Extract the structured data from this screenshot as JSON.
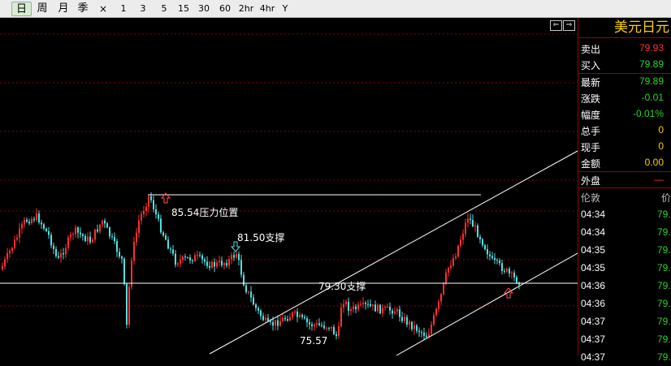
{
  "toolbar": {
    "day": "日",
    "week": "周",
    "month": "月",
    "season": "季",
    "close": "×",
    "m1": "1",
    "m3": "3",
    "m5": "5",
    "m15": "15",
    "m30": "30",
    "m60": "60",
    "h2": "2hr",
    "h4": "4hr",
    "year": "Y"
  },
  "annotations": {
    "resistance": "85.54压力位置",
    "support1": "81.50支撑",
    "support2": "79.30支撑",
    "low": "75.57"
  },
  "panel": {
    "title": "美元日元",
    "sell_label": "卖出",
    "sell_value": "79.93",
    "buy_label": "买入",
    "buy_value": "79.89",
    "latest_label": "最新",
    "latest_value": "79.89",
    "change_label": "涨跌",
    "change_value": "-0.01",
    "pct_label": "幅度",
    "pct_value": "-0.01%",
    "volume_label": "总手",
    "volume_value": "0",
    "current_label": "现手",
    "current_value": "0",
    "amount_label": "金额",
    "amount_value": "0.00",
    "outer_label": "外盘",
    "outer_value": "—",
    "ticks_header_left": "伦敦",
    "ticks_header_right": "价",
    "ticks": [
      {
        "time": "04:34",
        "price": "79."
      },
      {
        "time": "04:34",
        "price": "79."
      },
      {
        "time": "04:35",
        "price": "79."
      },
      {
        "time": "04:35",
        "price": "79."
      },
      {
        "time": "04:36",
        "price": "79."
      },
      {
        "time": "04:36",
        "price": "79."
      },
      {
        "time": "04:37",
        "price": "79."
      },
      {
        "time": "04:37",
        "price": "79."
      },
      {
        "time": "04:37",
        "price": "79."
      }
    ]
  },
  "colors": {
    "up": "#ff3030",
    "down": "#54e0e0",
    "grid": "#8a0000",
    "accent": "#f7d000",
    "positive": "#2ed42e"
  },
  "icons": {
    "nav_left": "scroll-left-icon",
    "nav_right": "scroll-right-icon",
    "resistance_arrow": "arrow-up-icon",
    "support_arrow": "arrow-down-icon"
  }
}
